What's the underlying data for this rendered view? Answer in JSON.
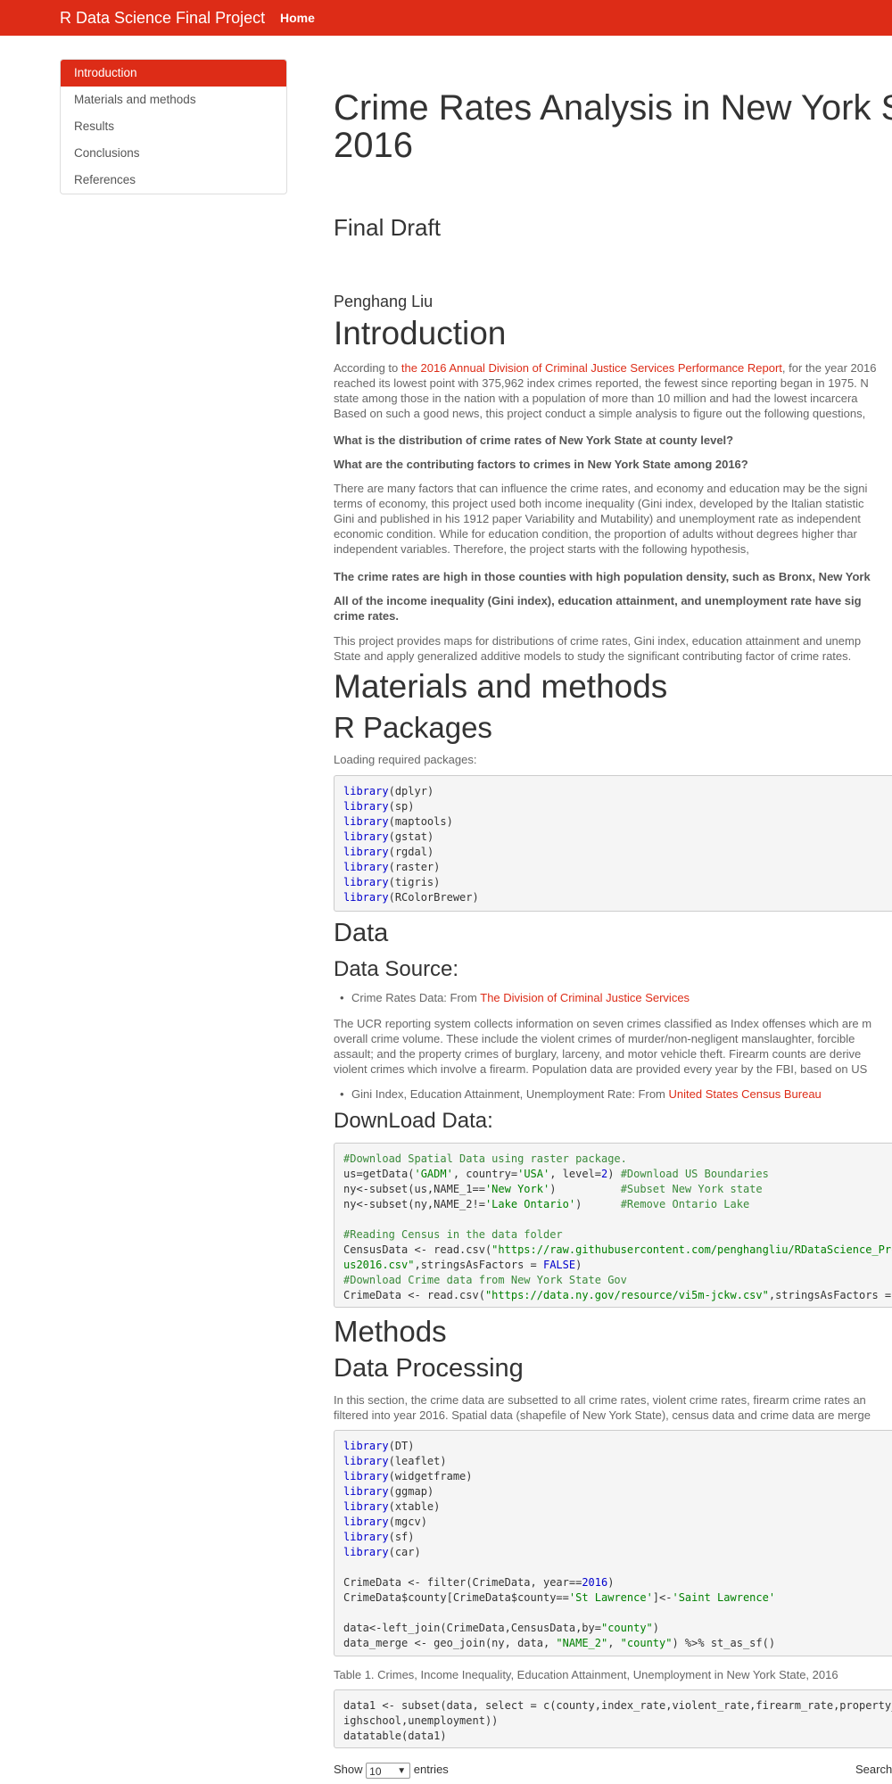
{
  "navbar": {
    "brand": "R Data Science Final Project",
    "home": "Home"
  },
  "toc": [
    {
      "label": "Introduction",
      "active": true
    },
    {
      "label": "Materials and methods"
    },
    {
      "label": "Results"
    },
    {
      "label": "Conclusions"
    },
    {
      "label": "References"
    }
  ],
  "header": {
    "title_line1": "Crime Rates Analysis in New York St",
    "title_line2": "2016",
    "subtitle": "Final Draft",
    "author": "Penghang Liu"
  },
  "intro": {
    "heading": "Introduction",
    "p1_prefix": "According to ",
    "p1_link": "the 2016 Annual Division of Criminal Justice Services Performance Report",
    "p1_suffix": ", for the year 2016",
    "p1_lines": [
      "reached its lowest point with 375,962 index crimes reported, the fewest since reporting began in 1975. N",
      "state among those in the nation with a population of more than 10 million and had the lowest incarcera",
      "Based on such a good news, this project conduct a simple analysis to figure out the following questions,"
    ],
    "q1": "What is the distribution of crime rates of New York State at county level?",
    "q2": "What are the contributing factors to crimes in New York State among 2016?",
    "p2_lines": [
      "There are many factors that can influence the crime rates, and economy and education may be the signi",
      "terms of economy, this project used both income inequality (Gini index, developed by the Italian statistic",
      "Gini and published in his 1912 paper Variability and Mutability) and unemployment rate as independent",
      "economic condition. While for education condition, the proportion of adults without degrees higher thar",
      "independent variables. Therefore, the project starts with the following hypothesis,"
    ],
    "h1": "The crime rates are high in those counties with high population density, such as Bronx, New York",
    "h2_line1": "All of the income inequality (Gini index), education attainment, and unemployment rate have sig",
    "h2_line2": "crime rates.",
    "p3_lines": [
      "This project provides maps for distributions of crime rates, Gini index, education attainment and unemp",
      "State and apply generalized additive models to study the significant contributing factor of crime rates."
    ]
  },
  "materials": {
    "heading": "Materials and methods",
    "rpackages": "R Packages",
    "loading": "Loading required packages:",
    "libs1": [
      "dplyr",
      "sp",
      "maptools",
      "gstat",
      "rgdal",
      "raster",
      "tigris",
      "RColorBrewer"
    ],
    "data_heading": "Data",
    "source_heading": "Data Source:",
    "bullet1_prefix": "Crime Rates Data: From ",
    "bullet1_link": "The Division of Criminal Justice Services",
    "ucr_lines": [
      "The UCR reporting system collects information on seven crimes classified as Index offenses which are m",
      "overall crime volume. These include the violent crimes of murder/non-negligent manslaughter, forcible",
      "assault; and the property crimes of burglary, larceny, and motor vehicle theft. Firearm counts are derive",
      "violent crimes which involve a firearm. Population data are provided every year by the FBI, based on US"
    ],
    "bullet2_prefix": "Gini Index, Education Attainment, Unemployment Rate: From ",
    "bullet2_link": "United States Census Bureau",
    "download_heading": "DownLoad Data:"
  },
  "methods": {
    "heading": "Methods",
    "processing": "Data Processing",
    "proc_lines": [
      "In this section, the crime data are subsetted to all crime rates, violent crime rates, firearm crime rates an",
      "filtered into year 2016. Spatial data (shapefile of New York State), census data and crime data are merge"
    ],
    "libs2": [
      "DT",
      "leaflet",
      "widgetframe",
      "ggmap",
      "xtable",
      "mgcv",
      "sf",
      "car"
    ],
    "table_caption": "Table 1. Crimes, Income Inequality, Education Attainment, Unemployment in New York State, 2016",
    "show_label": "Show",
    "show_value": "10",
    "entries_label": "entries",
    "search_label": "Search"
  },
  "code_keyword": "library"
}
